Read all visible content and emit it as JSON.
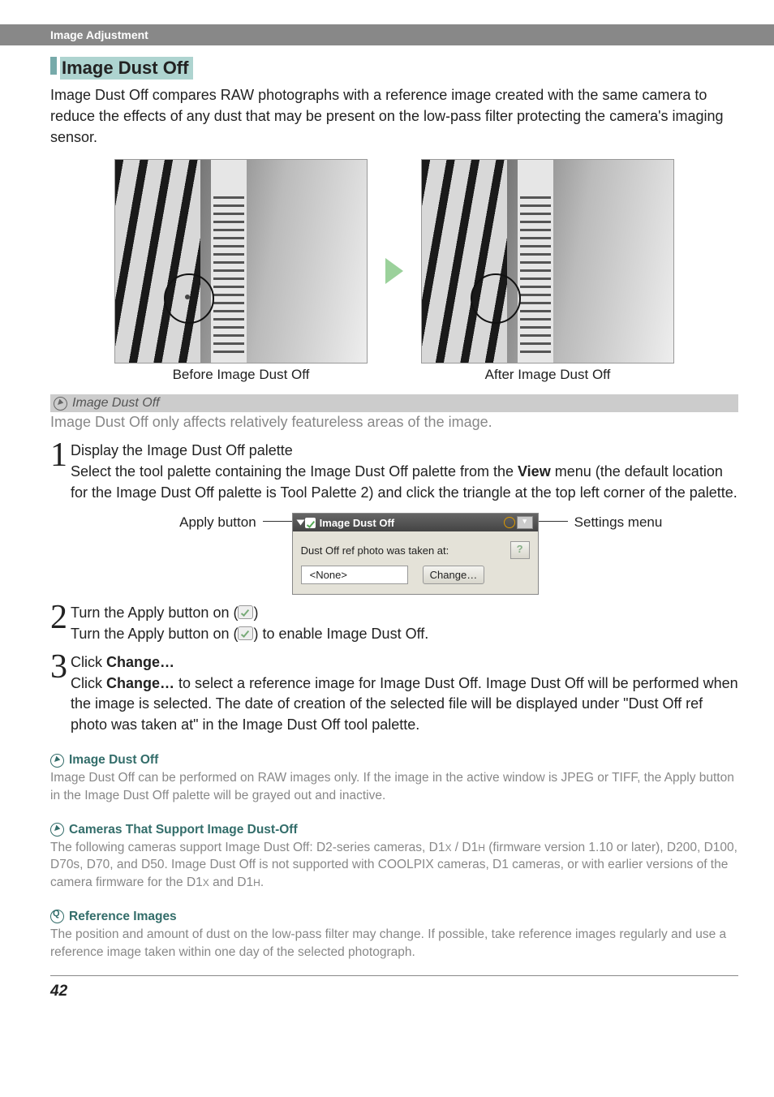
{
  "tab": "Image Adjustment",
  "h2": "Image Dust Off",
  "intro": "Image Dust Off compares RAW photographs with a reference image created with the same camera to reduce the effects of any dust that may be present on the low-pass filter protecting the camera's imaging sensor.",
  "cap_before": "Before Image Dust Off",
  "cap_after": "After Image Dust Off",
  "note1_title": "Image Dust Off",
  "note1_body": "Image Dust Off only affects relatively featureless areas of the image.",
  "s1_title": "Display the Image Dust Off palette",
  "s1_a": "Select the tool palette containing the Image Dust Off palette from the ",
  "s1_view": "View",
  "s1_b": " menu (the default location for the Image Dust Off palette is Tool Palette 2) and click the triangle at the top left corner of the palette.",
  "apply_label": "Apply button",
  "settings_label": "Settings menu",
  "pal_title": "Image Dust Off",
  "pal_line": "Dust Off ref photo was taken at:",
  "pal_none": "<None>",
  "pal_change": "Change…",
  "s2_title": "Turn the Apply button on (",
  "s2_title_end": ")",
  "s2_a": "Turn the Apply button on (",
  "s2_b": ") to enable Image Dust Off.",
  "s3_title_a": "Click ",
  "s3_title_b": "Change…",
  "s3_a": "Click ",
  "s3_b": "Change…",
  "s3_c": " to select a reference image for Image Dust Off.  Image Dust Off will be performed when the image is selected.  The date of creation of the selected file will be displayed under \"Dust Off ref photo was taken at\" in the Image Dust Off tool palette.",
  "n2_h": "Image Dust Off",
  "n2_t": "Image Dust Off can be performed on RAW images only.  If the image in the active window is JPEG or TIFF, the Apply button in the Image Dust Off palette will be grayed out and inactive.",
  "n3_h": "Cameras That Support Image Dust-Off",
  "n3_a": "The following cameras support Image Dust Off: D2-series cameras, D1",
  "n3_b": " / D1",
  "n3_c": " (firmware version 1.10 or later), D200, D100, D70s, D70, and D50.  Image Dust Off is not supported with COOLPIX cameras, D1 cameras, or with earlier versions of the camera firmware for the D1",
  "n3_d": " and D1",
  "n3_e": ".",
  "n4_h": "Reference Images",
  "n4_t": "The position and amount of dust on the low-pass filter may change.  If possible, take reference images regularly and use a reference image taken within one day of the selected photograph.",
  "x": "X",
  "h": "H",
  "page": "42"
}
